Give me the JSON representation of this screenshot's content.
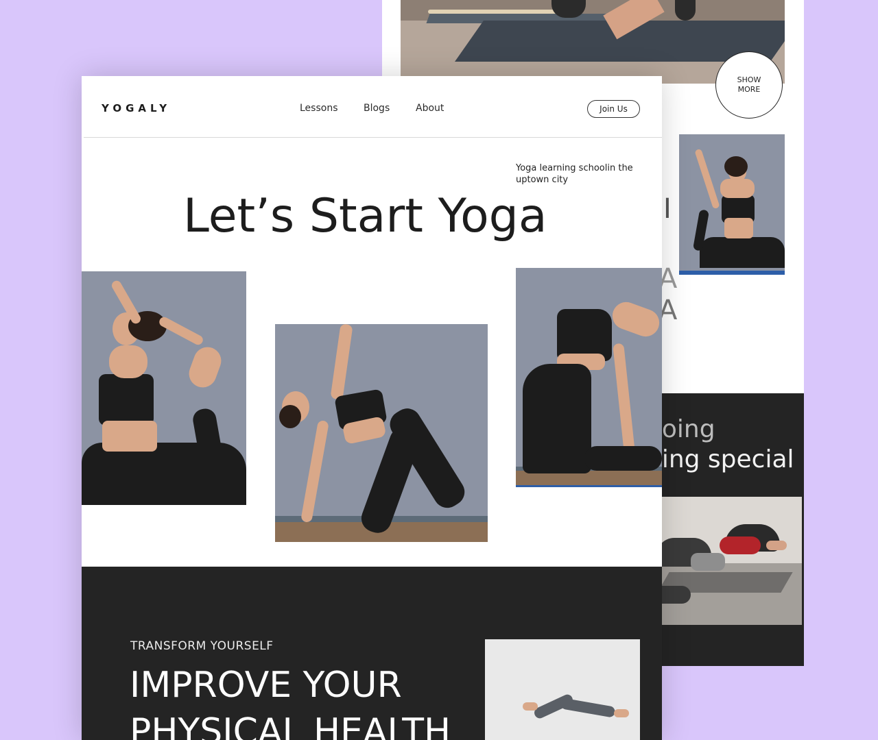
{
  "brand": {
    "logo": "YOGALY"
  },
  "nav": {
    "links": [
      "Lessons",
      "Blogs",
      "About"
    ],
    "join_label": "Join Us"
  },
  "hero": {
    "tagline": "Yoga learning schoolin the uptown city",
    "headline": "Let’s Start Yoga"
  },
  "back_page": {
    "show_more_label": "SHOW MORE",
    "vertical_letters": [
      "I",
      "A",
      "A"
    ],
    "quote_lines": [
      "doing",
      "ning special"
    ]
  },
  "transform": {
    "eyebrow": "TRANSFORM YOURSELF",
    "title_line1": "IMPROVE YOUR",
    "title_line2": "PHYSICAL HEALTH"
  },
  "colors": {
    "background": "#d9c6fb",
    "page": "#ffffff",
    "dark_section": "#242424",
    "accent_text": "#1d1d1d"
  }
}
